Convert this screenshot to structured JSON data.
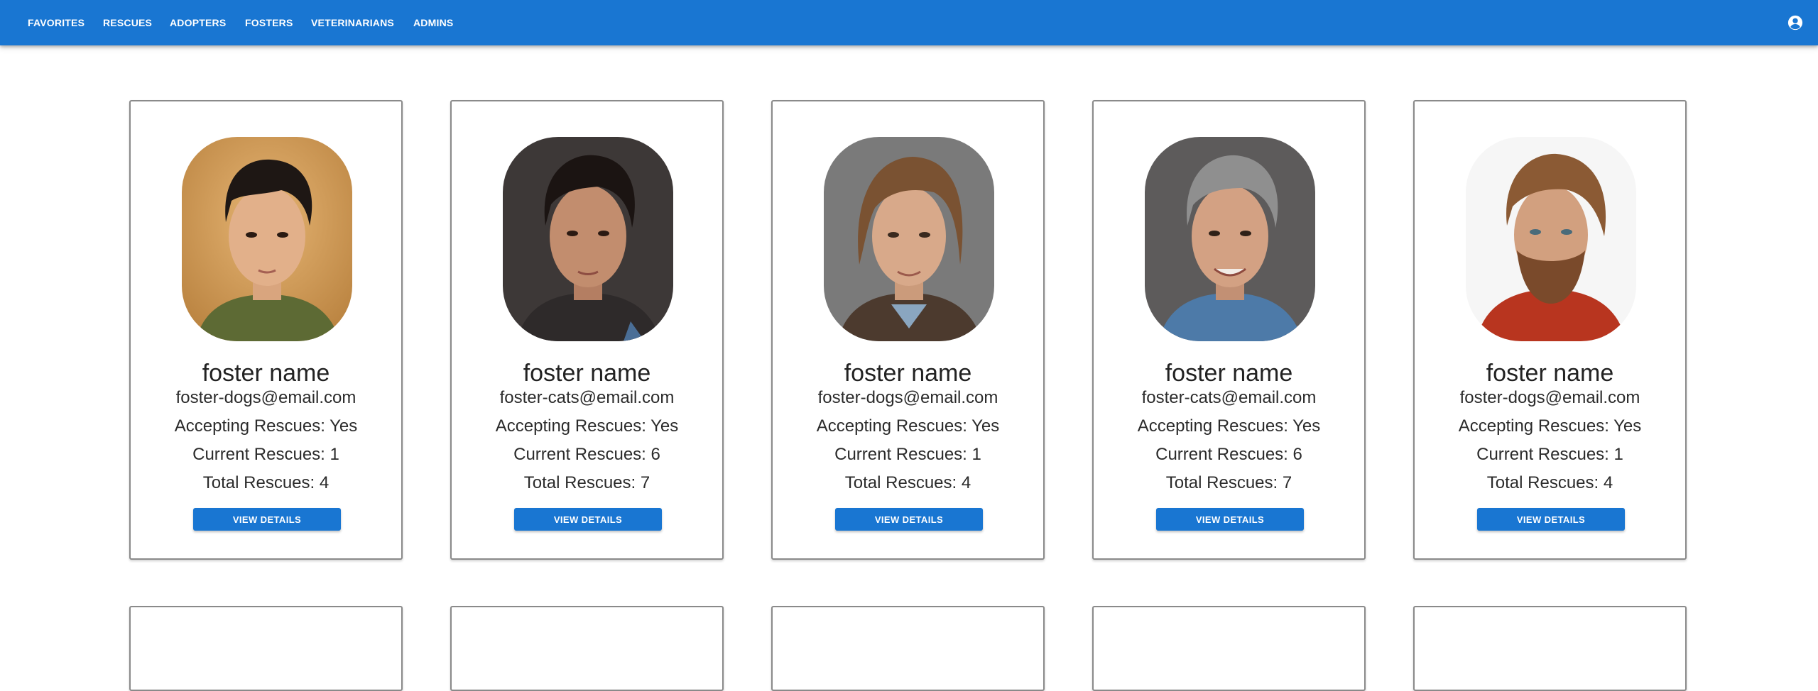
{
  "nav": {
    "items": [
      {
        "label": "FAVORITES"
      },
      {
        "label": "RESCUES"
      },
      {
        "label": "ADOPTERS"
      },
      {
        "label": "FOSTERS"
      },
      {
        "label": "VETERINARIANS"
      },
      {
        "label": "ADMINS"
      }
    ],
    "account_icon": "account-circle-icon"
  },
  "colors": {
    "appbar": "#1976d2",
    "button": "#1976d2"
  },
  "cards": [
    {
      "name": "foster name",
      "email": "foster-dogs@email.com",
      "accepting": "Accepting Rescues: Yes",
      "current": "Current Rescues: 1",
      "total": "Total Rescues: 4",
      "button": "VIEW DETAILS"
    },
    {
      "name": "foster name",
      "email": "foster-cats@email.com",
      "accepting": "Accepting Rescues: Yes",
      "current": "Current Rescues: 6",
      "total": "Total Rescues: 7",
      "button": "VIEW DETAILS"
    },
    {
      "name": "foster name",
      "email": "foster-dogs@email.com",
      "accepting": "Accepting Rescues: Yes",
      "current": "Current Rescues: 1",
      "total": "Total Rescues: 4",
      "button": "VIEW DETAILS"
    },
    {
      "name": "foster name",
      "email": "foster-cats@email.com",
      "accepting": "Accepting Rescues: Yes",
      "current": "Current Rescues: 6",
      "total": "Total Rescues: 7",
      "button": "VIEW DETAILS"
    },
    {
      "name": "foster name",
      "email": "foster-dogs@email.com",
      "accepting": "Accepting Rescues: Yes",
      "current": "Current Rescues: 1",
      "total": "Total Rescues: 4",
      "button": "VIEW DETAILS"
    }
  ]
}
